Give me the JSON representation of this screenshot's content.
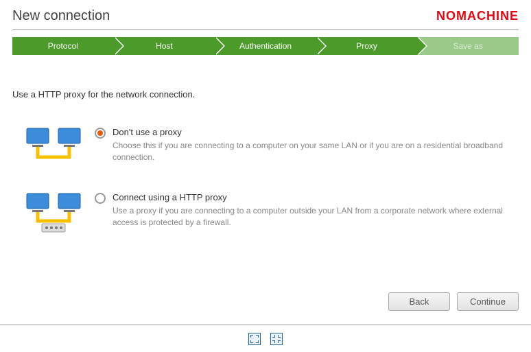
{
  "header": {
    "title": "New connection",
    "brand": "NOMACHINE"
  },
  "steps": [
    {
      "label": "Protocol",
      "active": true
    },
    {
      "label": "Host",
      "active": true
    },
    {
      "label": "Authentication",
      "active": true
    },
    {
      "label": "Proxy",
      "active": true
    },
    {
      "label": "Save as",
      "active": false
    }
  ],
  "instruction": "Use a HTTP proxy for the network connection.",
  "options": [
    {
      "title": "Don't use a proxy",
      "desc": "Choose this if you are connecting to a computer on your same LAN or if you are on a residential broadband connection.",
      "selected": true
    },
    {
      "title": "Connect using a HTTP proxy",
      "desc": "Use a proxy if you are connecting to a computer outside your LAN from a corporate network where external access is protected by a firewall.",
      "selected": false
    }
  ],
  "buttons": {
    "back": "Back",
    "continue": "Continue"
  }
}
